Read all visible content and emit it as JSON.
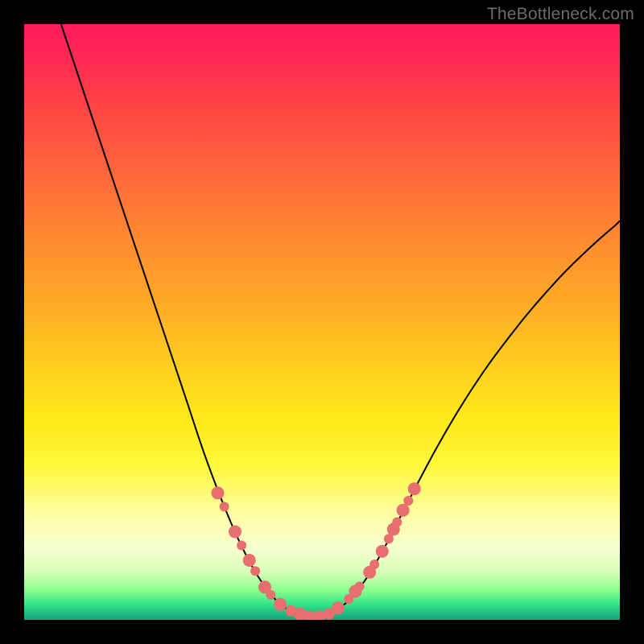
{
  "watermark": "TheBottleneck.com",
  "chart_data": {
    "type": "line",
    "title": "",
    "xlabel": "",
    "ylabel": "",
    "xlim_fraction": [
      0,
      1
    ],
    "ylim_fraction": [
      0,
      1
    ],
    "series": [
      {
        "name": "bottleneck-curve",
        "description": "V-shaped curve. Left branch falls steeply from top-left toward a broad minimum near the lower-center; right branch rises with shallower slope toward the upper-right edge.",
        "points_fraction": [
          {
            "x": 0.062,
            "y": 1.0
          },
          {
            "x": 0.092,
            "y": 0.91
          },
          {
            "x": 0.122,
            "y": 0.82
          },
          {
            "x": 0.152,
            "y": 0.73
          },
          {
            "x": 0.182,
            "y": 0.64
          },
          {
            "x": 0.212,
            "y": 0.55
          },
          {
            "x": 0.242,
            "y": 0.46
          },
          {
            "x": 0.272,
            "y": 0.37
          },
          {
            "x": 0.302,
            "y": 0.28
          },
          {
            "x": 0.332,
            "y": 0.2
          },
          {
            "x": 0.362,
            "y": 0.13
          },
          {
            "x": 0.392,
            "y": 0.074
          },
          {
            "x": 0.422,
            "y": 0.034
          },
          {
            "x": 0.452,
            "y": 0.012
          },
          {
            "x": 0.482,
            "y": 0.005
          },
          {
            "x": 0.512,
            "y": 0.01
          },
          {
            "x": 0.542,
            "y": 0.03
          },
          {
            "x": 0.572,
            "y": 0.066
          },
          {
            "x": 0.602,
            "y": 0.116
          },
          {
            "x": 0.632,
            "y": 0.174
          },
          {
            "x": 0.662,
            "y": 0.232
          },
          {
            "x": 0.692,
            "y": 0.288
          },
          {
            "x": 0.722,
            "y": 0.34
          },
          {
            "x": 0.752,
            "y": 0.388
          },
          {
            "x": 0.782,
            "y": 0.432
          },
          {
            "x": 0.812,
            "y": 0.472
          },
          {
            "x": 0.842,
            "y": 0.51
          },
          {
            "x": 0.872,
            "y": 0.545
          },
          {
            "x": 0.902,
            "y": 0.578
          },
          {
            "x": 0.932,
            "y": 0.608
          },
          {
            "x": 0.962,
            "y": 0.636
          },
          {
            "x": 0.992,
            "y": 0.662
          },
          {
            "x": 1.0,
            "y": 0.67
          }
        ]
      }
    ],
    "markers": {
      "name": "highlight-dots",
      "color": "#e76f6f",
      "radius_px_small": 6,
      "radius_px_large": 8,
      "points_fraction": [
        {
          "x": 0.325,
          "y": 0.213,
          "r": 8
        },
        {
          "x": 0.336,
          "y": 0.19,
          "r": 6
        },
        {
          "x": 0.354,
          "y": 0.148,
          "r": 8
        },
        {
          "x": 0.365,
          "y": 0.125,
          "r": 6
        },
        {
          "x": 0.378,
          "y": 0.1,
          "r": 8
        },
        {
          "x": 0.388,
          "y": 0.082,
          "r": 6
        },
        {
          "x": 0.404,
          "y": 0.055,
          "r": 8
        },
        {
          "x": 0.414,
          "y": 0.042,
          "r": 6
        },
        {
          "x": 0.43,
          "y": 0.026,
          "r": 8
        },
        {
          "x": 0.448,
          "y": 0.015,
          "r": 7
        },
        {
          "x": 0.463,
          "y": 0.01,
          "r": 8
        },
        {
          "x": 0.478,
          "y": 0.006,
          "r": 7
        },
        {
          "x": 0.495,
          "y": 0.005,
          "r": 8
        },
        {
          "x": 0.512,
          "y": 0.01,
          "r": 7
        },
        {
          "x": 0.527,
          "y": 0.02,
          "r": 8
        },
        {
          "x": 0.545,
          "y": 0.035,
          "r": 6
        },
        {
          "x": 0.556,
          "y": 0.048,
          "r": 8
        },
        {
          "x": 0.563,
          "y": 0.056,
          "r": 6
        },
        {
          "x": 0.58,
          "y": 0.08,
          "r": 8
        },
        {
          "x": 0.588,
          "y": 0.093,
          "r": 6
        },
        {
          "x": 0.601,
          "y": 0.115,
          "r": 8
        },
        {
          "x": 0.612,
          "y": 0.136,
          "r": 6
        },
        {
          "x": 0.62,
          "y": 0.152,
          "r": 8
        },
        {
          "x": 0.626,
          "y": 0.164,
          "r": 6
        },
        {
          "x": 0.636,
          "y": 0.184,
          "r": 8
        },
        {
          "x": 0.645,
          "y": 0.2,
          "r": 6
        },
        {
          "x": 0.655,
          "y": 0.22,
          "r": 8
        }
      ]
    },
    "background_gradient_stops": [
      {
        "pos": 0.0,
        "color": "#ff1a5e"
      },
      {
        "pos": 0.14,
        "color": "#ff4545"
      },
      {
        "pos": 0.36,
        "color": "#ff8a30"
      },
      {
        "pos": 0.58,
        "color": "#ffd01e"
      },
      {
        "pos": 0.74,
        "color": "#fff83a"
      },
      {
        "pos": 0.88,
        "color": "#f7ffcf"
      },
      {
        "pos": 0.95,
        "color": "#8cff8c"
      },
      {
        "pos": 1.0,
        "color": "#12a47a"
      }
    ]
  }
}
